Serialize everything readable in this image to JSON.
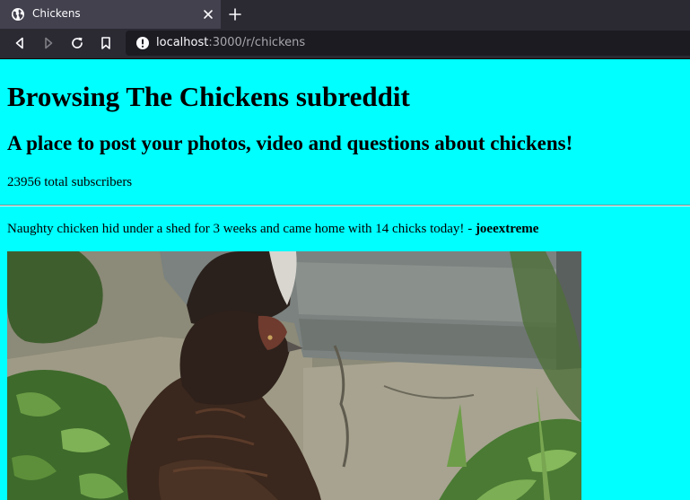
{
  "browser": {
    "tab_title": "Chickens",
    "url_host": "localhost",
    "url_rest": ":3000/r/chickens",
    "icons": {
      "favicon": "globe-icon",
      "close": "close-icon",
      "new_tab": "plus-icon",
      "back": "back-icon",
      "forward": "forward-icon",
      "reload": "reload-icon",
      "bookmark": "bookmark-icon",
      "site_info": "info-icon"
    },
    "colors": {
      "chrome": "#2b2a33",
      "active_tab": "#42414d",
      "urlbar": "#1c1b22"
    }
  },
  "page": {
    "background": "#00ffff",
    "title": "Browsing The Chickens subreddit",
    "subtitle": "A place to post your photos, video and questions about chickens!",
    "subscribers": "23956 total subscribers",
    "posts": [
      {
        "title": "Naughty chicken hid under a shed for 3 weeks and came home with 14 chicks today!",
        "separator": " - ",
        "author": "joeextreme",
        "image": "photo of a dark brown hen standing on a concrete path in front of a grey shed with green plants"
      }
    ]
  }
}
